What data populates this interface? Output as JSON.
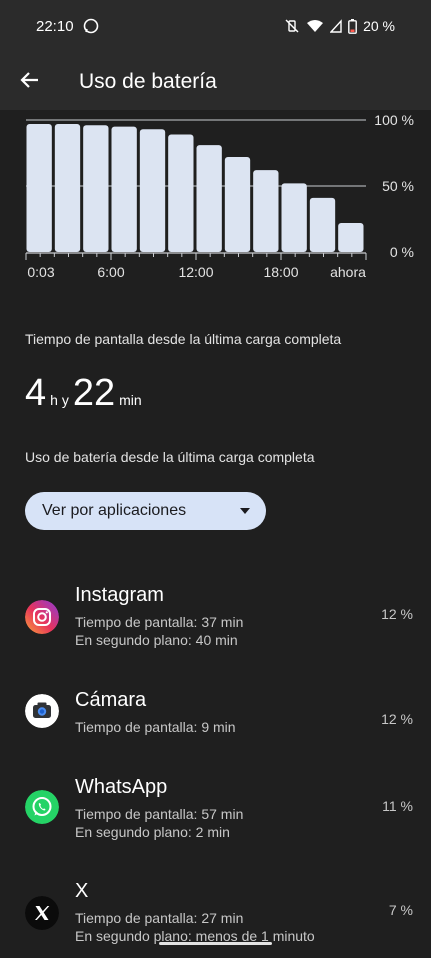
{
  "status": {
    "time": "22:10",
    "battery": "20 %"
  },
  "appbar": {
    "title": "Uso de batería"
  },
  "chart_data": {
    "type": "bar",
    "x_ticks": [
      "0:03",
      "6:00",
      "12:00",
      "18:00",
      "ahora"
    ],
    "y_ticks": [
      "100 %",
      "50 %",
      "0 %"
    ],
    "ylim": [
      0,
      100
    ],
    "values": [
      97,
      97,
      96,
      95,
      93,
      89,
      81,
      72,
      62,
      52,
      41,
      22
    ],
    "grid": true
  },
  "screen_time": {
    "heading": "Tiempo de pantalla desde la última carga completa",
    "hours": "4",
    "hours_unit": "h y",
    "minutes": "22",
    "minutes_unit": "min"
  },
  "usage": {
    "heading": "Uso de batería desde la última carga completa",
    "dropdown": "Ver por aplicaciones"
  },
  "apps": [
    {
      "name": "Instagram",
      "line1": "Tiempo de pantalla: 37 min",
      "line2": "En segundo plano: 40 min",
      "pct": "12 %",
      "icon": "instagram-icon"
    },
    {
      "name": "Cámara",
      "line1": "Tiempo de pantalla: 9 min",
      "line2": "",
      "pct": "12 %",
      "icon": "camera-icon"
    },
    {
      "name": "WhatsApp",
      "line1": "Tiempo de pantalla: 57 min",
      "line2": "En segundo plano: 2 min",
      "pct": "11 %",
      "icon": "whatsapp-icon"
    },
    {
      "name": "X",
      "line1": "Tiempo de pantalla: 27 min",
      "line2": "En segundo plano: menos de 1 minuto",
      "pct": "7 %",
      "icon": "x-icon"
    }
  ],
  "colors": {
    "bar": "#dce4f2",
    "background": "#1f1f1f",
    "header": "#2b2b2b",
    "chip": "#d7e3f7"
  }
}
